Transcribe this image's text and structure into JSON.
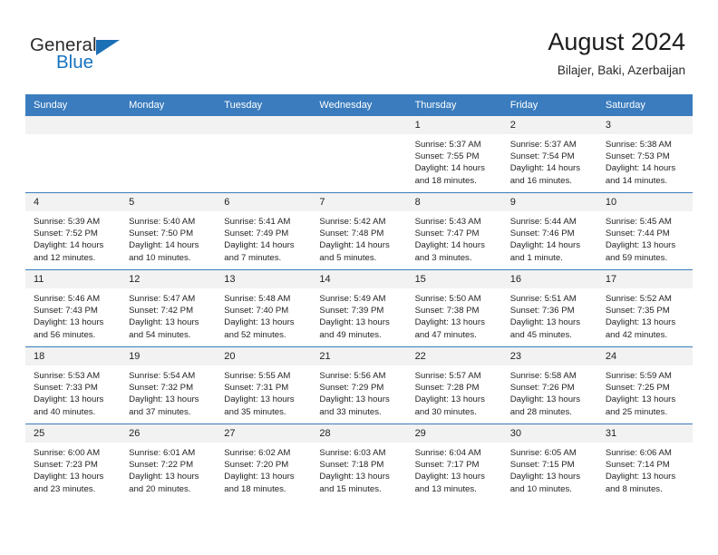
{
  "brand": {
    "word_one": "General",
    "word_two": "Blue",
    "triangle_icon": "triangle-logo-icon",
    "accent_color": "#1b6fb5"
  },
  "header": {
    "title": "August 2024",
    "location": "Bilajer, Baki, Azerbaijan"
  },
  "colors": {
    "header_row_background": "#3a7cbe",
    "day_number_background": "#f2f2f2",
    "grid_line": "#3a7cbe",
    "text": "#242424"
  },
  "weekday_headers": [
    "Sunday",
    "Monday",
    "Tuesday",
    "Wednesday",
    "Thursday",
    "Friday",
    "Saturday"
  ],
  "labels": {
    "sunrise_prefix": "Sunrise:",
    "sunset_prefix": "Sunset:",
    "daylight_prefix": "Daylight:"
  },
  "weeks": [
    [
      {
        "day": "",
        "empty": true,
        "line1": "",
        "line2": "",
        "line3": "",
        "line4": ""
      },
      {
        "day": "",
        "empty": true,
        "line1": "",
        "line2": "",
        "line3": "",
        "line4": ""
      },
      {
        "day": "",
        "empty": true,
        "line1": "",
        "line2": "",
        "line3": "",
        "line4": ""
      },
      {
        "day": "",
        "empty": true,
        "line1": "",
        "line2": "",
        "line3": "",
        "line4": ""
      },
      {
        "day": "1",
        "empty": false,
        "line1": "Sunrise: 5:37 AM",
        "line2": "Sunset: 7:55 PM",
        "line3": "Daylight: 14 hours",
        "line4": "and 18 minutes."
      },
      {
        "day": "2",
        "empty": false,
        "line1": "Sunrise: 5:37 AM",
        "line2": "Sunset: 7:54 PM",
        "line3": "Daylight: 14 hours",
        "line4": "and 16 minutes."
      },
      {
        "day": "3",
        "empty": false,
        "line1": "Sunrise: 5:38 AM",
        "line2": "Sunset: 7:53 PM",
        "line3": "Daylight: 14 hours",
        "line4": "and 14 minutes."
      }
    ],
    [
      {
        "day": "4",
        "empty": false,
        "line1": "Sunrise: 5:39 AM",
        "line2": "Sunset: 7:52 PM",
        "line3": "Daylight: 14 hours",
        "line4": "and 12 minutes."
      },
      {
        "day": "5",
        "empty": false,
        "line1": "Sunrise: 5:40 AM",
        "line2": "Sunset: 7:50 PM",
        "line3": "Daylight: 14 hours",
        "line4": "and 10 minutes."
      },
      {
        "day": "6",
        "empty": false,
        "line1": "Sunrise: 5:41 AM",
        "line2": "Sunset: 7:49 PM",
        "line3": "Daylight: 14 hours",
        "line4": "and 7 minutes."
      },
      {
        "day": "7",
        "empty": false,
        "line1": "Sunrise: 5:42 AM",
        "line2": "Sunset: 7:48 PM",
        "line3": "Daylight: 14 hours",
        "line4": "and 5 minutes."
      },
      {
        "day": "8",
        "empty": false,
        "line1": "Sunrise: 5:43 AM",
        "line2": "Sunset: 7:47 PM",
        "line3": "Daylight: 14 hours",
        "line4": "and 3 minutes."
      },
      {
        "day": "9",
        "empty": false,
        "line1": "Sunrise: 5:44 AM",
        "line2": "Sunset: 7:46 PM",
        "line3": "Daylight: 14 hours",
        "line4": "and 1 minute."
      },
      {
        "day": "10",
        "empty": false,
        "line1": "Sunrise: 5:45 AM",
        "line2": "Sunset: 7:44 PM",
        "line3": "Daylight: 13 hours",
        "line4": "and 59 minutes."
      }
    ],
    [
      {
        "day": "11",
        "empty": false,
        "line1": "Sunrise: 5:46 AM",
        "line2": "Sunset: 7:43 PM",
        "line3": "Daylight: 13 hours",
        "line4": "and 56 minutes."
      },
      {
        "day": "12",
        "empty": false,
        "line1": "Sunrise: 5:47 AM",
        "line2": "Sunset: 7:42 PM",
        "line3": "Daylight: 13 hours",
        "line4": "and 54 minutes."
      },
      {
        "day": "13",
        "empty": false,
        "line1": "Sunrise: 5:48 AM",
        "line2": "Sunset: 7:40 PM",
        "line3": "Daylight: 13 hours",
        "line4": "and 52 minutes."
      },
      {
        "day": "14",
        "empty": false,
        "line1": "Sunrise: 5:49 AM",
        "line2": "Sunset: 7:39 PM",
        "line3": "Daylight: 13 hours",
        "line4": "and 49 minutes."
      },
      {
        "day": "15",
        "empty": false,
        "line1": "Sunrise: 5:50 AM",
        "line2": "Sunset: 7:38 PM",
        "line3": "Daylight: 13 hours",
        "line4": "and 47 minutes."
      },
      {
        "day": "16",
        "empty": false,
        "line1": "Sunrise: 5:51 AM",
        "line2": "Sunset: 7:36 PM",
        "line3": "Daylight: 13 hours",
        "line4": "and 45 minutes."
      },
      {
        "day": "17",
        "empty": false,
        "line1": "Sunrise: 5:52 AM",
        "line2": "Sunset: 7:35 PM",
        "line3": "Daylight: 13 hours",
        "line4": "and 42 minutes."
      }
    ],
    [
      {
        "day": "18",
        "empty": false,
        "line1": "Sunrise: 5:53 AM",
        "line2": "Sunset: 7:33 PM",
        "line3": "Daylight: 13 hours",
        "line4": "and 40 minutes."
      },
      {
        "day": "19",
        "empty": false,
        "line1": "Sunrise: 5:54 AM",
        "line2": "Sunset: 7:32 PM",
        "line3": "Daylight: 13 hours",
        "line4": "and 37 minutes."
      },
      {
        "day": "20",
        "empty": false,
        "line1": "Sunrise: 5:55 AM",
        "line2": "Sunset: 7:31 PM",
        "line3": "Daylight: 13 hours",
        "line4": "and 35 minutes."
      },
      {
        "day": "21",
        "empty": false,
        "line1": "Sunrise: 5:56 AM",
        "line2": "Sunset: 7:29 PM",
        "line3": "Daylight: 13 hours",
        "line4": "and 33 minutes."
      },
      {
        "day": "22",
        "empty": false,
        "line1": "Sunrise: 5:57 AM",
        "line2": "Sunset: 7:28 PM",
        "line3": "Daylight: 13 hours",
        "line4": "and 30 minutes."
      },
      {
        "day": "23",
        "empty": false,
        "line1": "Sunrise: 5:58 AM",
        "line2": "Sunset: 7:26 PM",
        "line3": "Daylight: 13 hours",
        "line4": "and 28 minutes."
      },
      {
        "day": "24",
        "empty": false,
        "line1": "Sunrise: 5:59 AM",
        "line2": "Sunset: 7:25 PM",
        "line3": "Daylight: 13 hours",
        "line4": "and 25 minutes."
      }
    ],
    [
      {
        "day": "25",
        "empty": false,
        "line1": "Sunrise: 6:00 AM",
        "line2": "Sunset: 7:23 PM",
        "line3": "Daylight: 13 hours",
        "line4": "and 23 minutes."
      },
      {
        "day": "26",
        "empty": false,
        "line1": "Sunrise: 6:01 AM",
        "line2": "Sunset: 7:22 PM",
        "line3": "Daylight: 13 hours",
        "line4": "and 20 minutes."
      },
      {
        "day": "27",
        "empty": false,
        "line1": "Sunrise: 6:02 AM",
        "line2": "Sunset: 7:20 PM",
        "line3": "Daylight: 13 hours",
        "line4": "and 18 minutes."
      },
      {
        "day": "28",
        "empty": false,
        "line1": "Sunrise: 6:03 AM",
        "line2": "Sunset: 7:18 PM",
        "line3": "Daylight: 13 hours",
        "line4": "and 15 minutes."
      },
      {
        "day": "29",
        "empty": false,
        "line1": "Sunrise: 6:04 AM",
        "line2": "Sunset: 7:17 PM",
        "line3": "Daylight: 13 hours",
        "line4": "and 13 minutes."
      },
      {
        "day": "30",
        "empty": false,
        "line1": "Sunrise: 6:05 AM",
        "line2": "Sunset: 7:15 PM",
        "line3": "Daylight: 13 hours",
        "line4": "and 10 minutes."
      },
      {
        "day": "31",
        "empty": false,
        "line1": "Sunrise: 6:06 AM",
        "line2": "Sunset: 7:14 PM",
        "line3": "Daylight: 13 hours",
        "line4": "and 8 minutes."
      }
    ]
  ]
}
